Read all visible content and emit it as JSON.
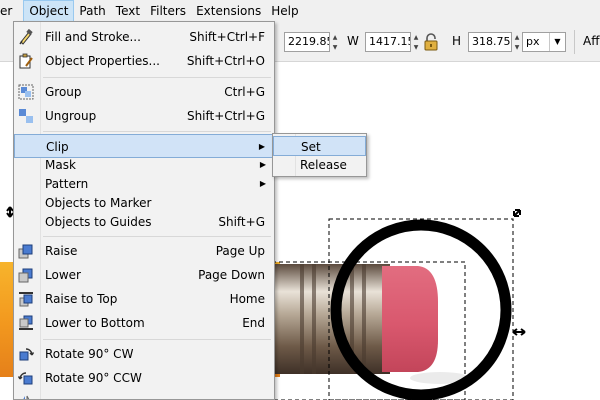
{
  "menubar": {
    "items": [
      {
        "label": "er",
        "key": "",
        "rest": "er"
      },
      {
        "label": "Object",
        "key": "O",
        "rest": "bject"
      },
      {
        "label": "Path",
        "key": "P",
        "rest": "ath"
      },
      {
        "label": "Text",
        "key": "T",
        "rest": "ext"
      },
      {
        "label": "Filters",
        "key": "",
        "rest": "Filters"
      },
      {
        "label": "Extensions",
        "key": "",
        "rest": "Extensions"
      },
      {
        "label": "Help",
        "key": "H",
        "rest": "elp"
      }
    ]
  },
  "toolbar": {
    "x_value": "2219.85",
    "w_label": "W",
    "w_value": "1417.15",
    "h_label": "H",
    "h_value": "318.750",
    "unit": "px",
    "aff_label": "Aff"
  },
  "object_menu": {
    "fill_stroke": {
      "label": "Fill and Stroke...",
      "accel": "Shift+Ctrl+F"
    },
    "object_properties": {
      "label": "Object Properties...",
      "accel": "Shift+Ctrl+O"
    },
    "group": {
      "label": "Group",
      "accel": "Ctrl+G"
    },
    "ungroup": {
      "label": "Ungroup",
      "accel": "Shift+Ctrl+G"
    },
    "clip": {
      "label": "Clip"
    },
    "mask": {
      "label": "Mask"
    },
    "pattern": {
      "label": "Pattern"
    },
    "objects_to_marker": {
      "label": "Objects to Marker"
    },
    "objects_to_guides": {
      "label": "Objects to Guides",
      "accel": "Shift+G"
    },
    "raise": {
      "label": "Raise",
      "accel": "Page Up"
    },
    "lower": {
      "label": "Lower",
      "accel": "Page Down"
    },
    "raise_to_top": {
      "label": "Raise to Top",
      "accel": "Home"
    },
    "lower_to_bottom": {
      "label": "Lower to Bottom",
      "accel": "End"
    },
    "rotate_cw": {
      "label": "Rotate 90° CW"
    },
    "rotate_ccw": {
      "label": "Rotate 90° CCW"
    }
  },
  "clip_submenu": {
    "set": {
      "label": "Set"
    },
    "release": {
      "label": "Release"
    }
  },
  "colors": {
    "menu_highlight": "#d1e3f7",
    "menubar_active": "#cce4f7",
    "eraser_pink": "#d9586e",
    "circle_stroke": "#000000"
  }
}
